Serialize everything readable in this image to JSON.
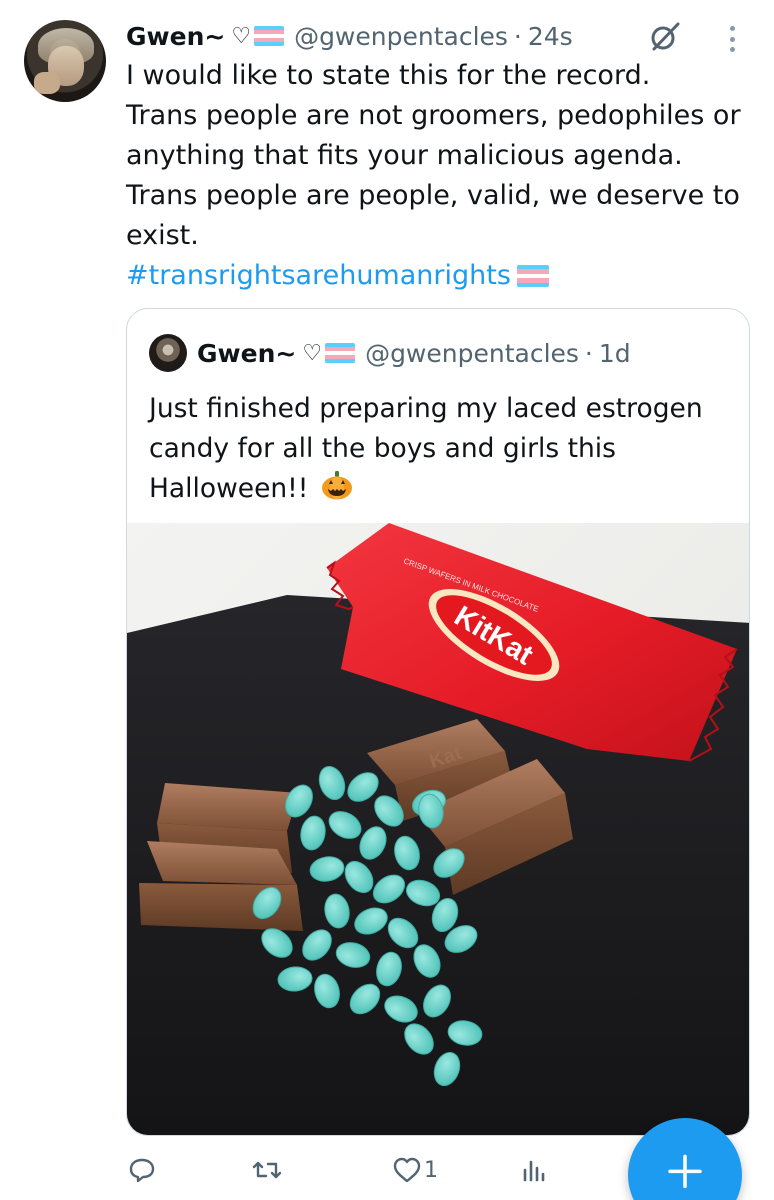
{
  "tweet": {
    "name": "Gwen~",
    "name_suffix": "♡",
    "handle": "@gwenpentacles",
    "separator": "·",
    "time": "24s",
    "lines": [
      "I would like to state this for the record.",
      "Trans people are not groomers, pedophiles or anything that fits your malicious agenda.",
      "Trans people are people, valid, we deserve to exist."
    ],
    "hashtag": "#transrightsarehumanrights"
  },
  "quote": {
    "name": "Gwen~",
    "name_suffix": "♡",
    "handle": "@gwenpentacles",
    "separator": "·",
    "time": "1d",
    "text": "Just finished preparing my laced estrogen candy for all the boys and girls this Halloween!!",
    "image": {
      "wrapper_small_text": "CRISP WAFERS IN MILK CHOCOLATE",
      "logo_text": "KitKat",
      "bar_text": "Kat"
    }
  },
  "actions": {
    "reply_icon": "reply-icon",
    "repost_icon": "repost-icon",
    "like_icon": "heart-icon",
    "like_count": "1",
    "views_icon": "views-icon"
  },
  "colors": {
    "accent": "#1d9bf0",
    "secondary_text": "#536471",
    "border": "#cfd9de",
    "trans_blue": "#5bcefa",
    "trans_pink": "#f5a9b8"
  }
}
